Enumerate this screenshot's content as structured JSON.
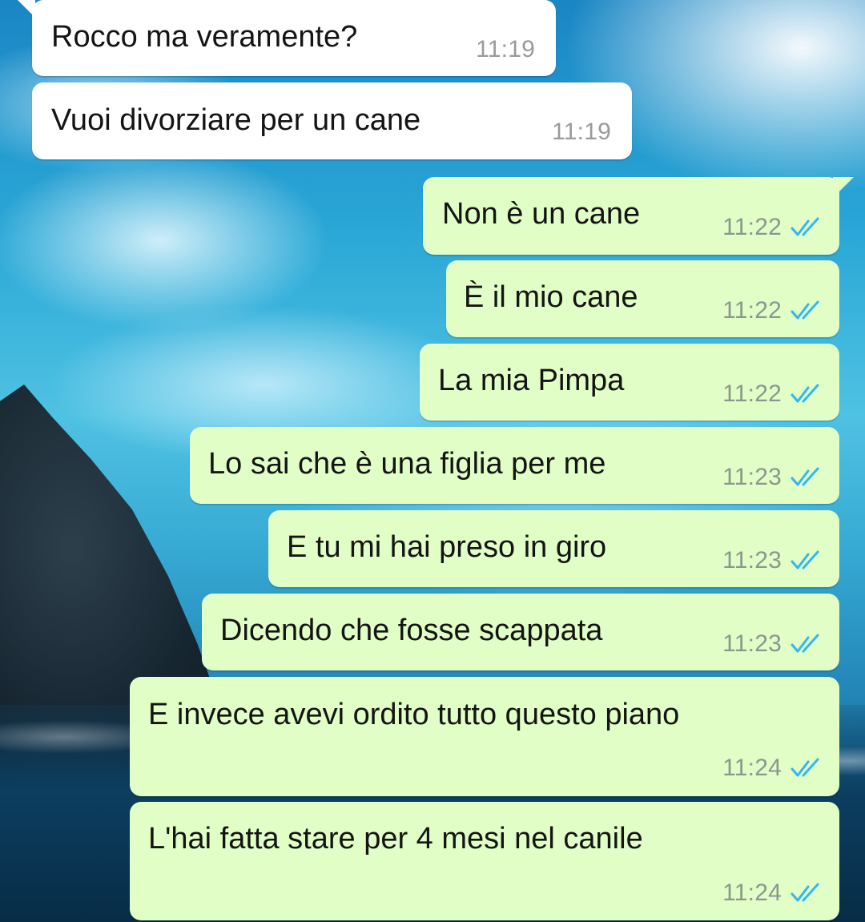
{
  "conversation": {
    "incoming": [
      {
        "text": "Rocco ma veramente?",
        "time": "11:19"
      },
      {
        "text": "Vuoi divorziare per un cane",
        "time": "11:19"
      }
    ],
    "outgoing": [
      {
        "text": "Non è un cane",
        "time": "11:22",
        "status": "read"
      },
      {
        "text": "È il mio cane",
        "time": "11:22",
        "status": "read"
      },
      {
        "text": "La mia Pimpa",
        "time": "11:22",
        "status": "read"
      },
      {
        "text": "Lo sai che è una figlia per me",
        "time": "11:23",
        "status": "read"
      },
      {
        "text": "E tu mi hai preso in giro",
        "time": "11:23",
        "status": "read"
      },
      {
        "text": "Dicendo che fosse scappata",
        "time": "11:23",
        "status": "read"
      },
      {
        "text": "E invece avevi ordito tutto questo piano",
        "time": "11:24",
        "status": "read"
      },
      {
        "text": "L'hai fatta stare per 4 mesi nel canile",
        "time": "11:24",
        "status": "read"
      }
    ]
  },
  "icons": {
    "read_receipt": "double-check-icon"
  },
  "colors": {
    "incoming_bubble": "#ffffff",
    "outgoing_bubble": "#e1fec6",
    "read_tick": "#34b7f1",
    "timestamp": "#8b968f",
    "message_text": "#141414"
  }
}
